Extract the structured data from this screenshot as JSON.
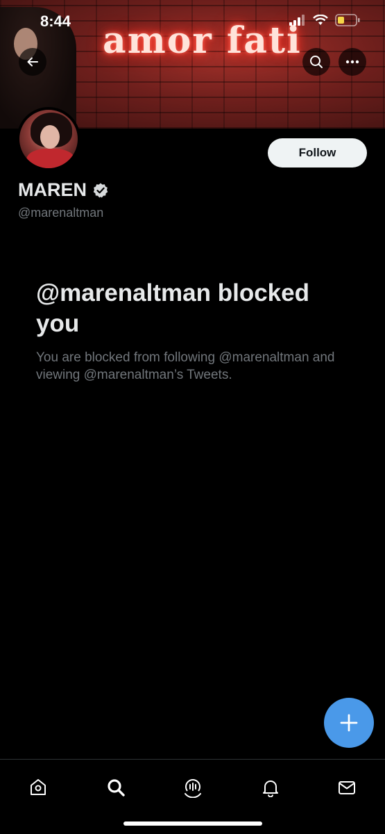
{
  "status_bar": {
    "time": "8:44"
  },
  "banner": {
    "neon_text": "amor fati"
  },
  "header": {
    "back_icon": "arrow-left-icon",
    "search_icon": "search-icon",
    "more_icon": "more-horizontal-icon"
  },
  "profile": {
    "display_name": "MAREN",
    "handle": "@marenaltman",
    "follow_label": "Follow",
    "verified": true
  },
  "blocked": {
    "title": "@marenaltman blocked you",
    "description": "You are blocked from following @marenaltman and viewing @marenaltman’s Tweets."
  },
  "tabs": [
    {
      "name": "home",
      "icon": "home-icon"
    },
    {
      "name": "search",
      "icon": "search-icon"
    },
    {
      "name": "spaces",
      "icon": "spaces-icon"
    },
    {
      "name": "notifications",
      "icon": "bell-icon"
    },
    {
      "name": "messages",
      "icon": "mail-icon"
    }
  ],
  "colors": {
    "accent": "#4a99e9",
    "background": "#000000",
    "muted_text": "#71767b",
    "battery": "#f5d547"
  }
}
